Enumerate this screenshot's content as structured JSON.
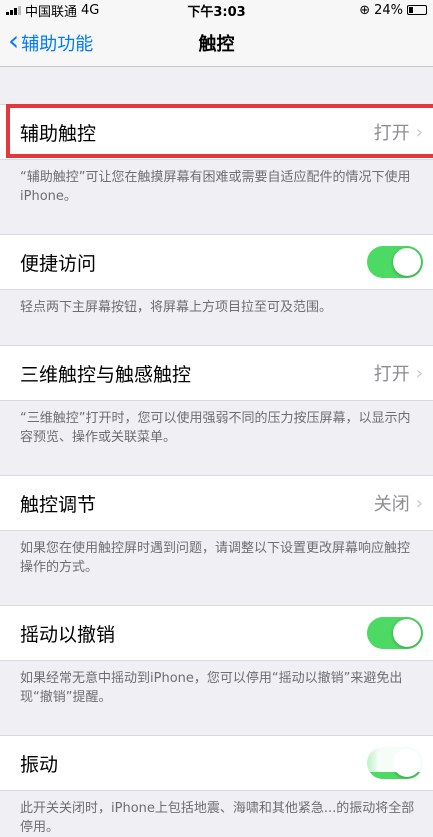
{
  "status": {
    "carrier": "中国联通",
    "network": "4G",
    "time": "下午3:03",
    "battery": "24%"
  },
  "nav": {
    "back": "辅助功能",
    "title": "触控"
  },
  "sections": [
    {
      "label": "辅助触控",
      "value": "打开",
      "note": "“辅助触控”可让您在触摸屏幕有困难或需要自适应配件的情况下使用 iPhone。"
    },
    {
      "label": "便捷访问",
      "toggle": "on",
      "note": "轻点两下主屏幕按钮，将屏幕上方项目拉至可及范围。"
    },
    {
      "label": "三维触控与触感触控",
      "value": "打开",
      "note": "“三维触控”打开时，您可以使用强弱不同的压力按压屏幕，以显示内容预览、操作或关联菜单。"
    },
    {
      "label": "触控调节",
      "value": "关闭",
      "note": "如果您在使用触控屏时遇到问题，请调整以下设置更改屏幕响应触控操作的方式。"
    },
    {
      "label": "摇动以撤销",
      "toggle": "on",
      "note": "如果经常无意中摇动到iPhone，您可以停用“摇动以撤销”来避免出现“撤销”提醒。"
    },
    {
      "label": "振动",
      "toggle": "on",
      "note": "此开关关闭时，iPhone上包括地震、海啸和其他紧急...的振动将全部停用。"
    }
  ],
  "colors": {
    "accent": "#007aff",
    "toggle_on": "#4cd964",
    "highlight": "#e5383b"
  }
}
